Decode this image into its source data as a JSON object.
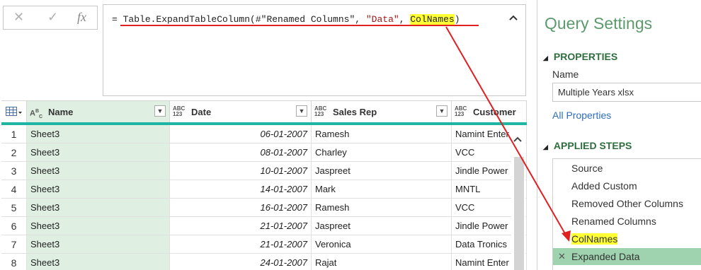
{
  "formula_bar": {
    "cancel_glyph": "✕",
    "confirm_glyph": "✓",
    "fx_label": "fx",
    "prefix": "= ",
    "func": "Table.ExpandTableColumn",
    "args_open": "(#\"Renamed Columns\", ",
    "arg_string": "\"Data\"",
    "sep": ", ",
    "arg_highlight": "ColNames",
    "args_close": ")",
    "collapse_icon": "chevron-up-icon"
  },
  "grid": {
    "type_badge_abc": "ABC",
    "type_badge_123": "123",
    "columns": [
      {
        "name": "Name",
        "type": "ABC"
      },
      {
        "name": "Date",
        "type": "ABC123"
      },
      {
        "name": "Sales Rep",
        "type": "ABC123"
      },
      {
        "name": "Customer",
        "type": "ABC123"
      }
    ],
    "rows": [
      {
        "idx": "1",
        "name": "Sheet3",
        "date": "06-01-2007",
        "rep": "Ramesh",
        "cust": "Namint Enter"
      },
      {
        "idx": "2",
        "name": "Sheet3",
        "date": "08-01-2007",
        "rep": "Charley",
        "cust": "VCC"
      },
      {
        "idx": "3",
        "name": "Sheet3",
        "date": "10-01-2007",
        "rep": "Jaspreet",
        "cust": "Jindle Power"
      },
      {
        "idx": "4",
        "name": "Sheet3",
        "date": "14-01-2007",
        "rep": "Mark",
        "cust": "MNTL"
      },
      {
        "idx": "5",
        "name": "Sheet3",
        "date": "16-01-2007",
        "rep": "Ramesh",
        "cust": "VCC"
      },
      {
        "idx": "6",
        "name": "Sheet3",
        "date": "21-01-2007",
        "rep": "Jaspreet",
        "cust": "Jindle Power"
      },
      {
        "idx": "7",
        "name": "Sheet3",
        "date": "21-01-2007",
        "rep": "Veronica",
        "cust": "Data Tronics"
      },
      {
        "idx": "8",
        "name": "Sheet3",
        "date": "24-01-2007",
        "rep": "Rajat",
        "cust": "Namint Enter"
      }
    ]
  },
  "query_settings": {
    "title": "Query Settings",
    "properties_header": "PROPERTIES",
    "name_label": "Name",
    "name_value": "Multiple Years xlsx",
    "all_properties_link": "All Properties",
    "applied_steps_header": "APPLIED STEPS",
    "steps": [
      "Source",
      "Added Custom",
      "Removed Other Columns",
      "Renamed Columns",
      "ColNames",
      "Expanded Data"
    ],
    "active_step": "Expanded Data",
    "highlighted_step": "ColNames"
  },
  "colors": {
    "accent_teal": "#1fb5a5",
    "selected_column": "#dff0e3",
    "active_step": "#9fd3b0",
    "highlight": "#ffff33",
    "annotation_red": "#e02020",
    "title_green": "#5c9a6e"
  }
}
